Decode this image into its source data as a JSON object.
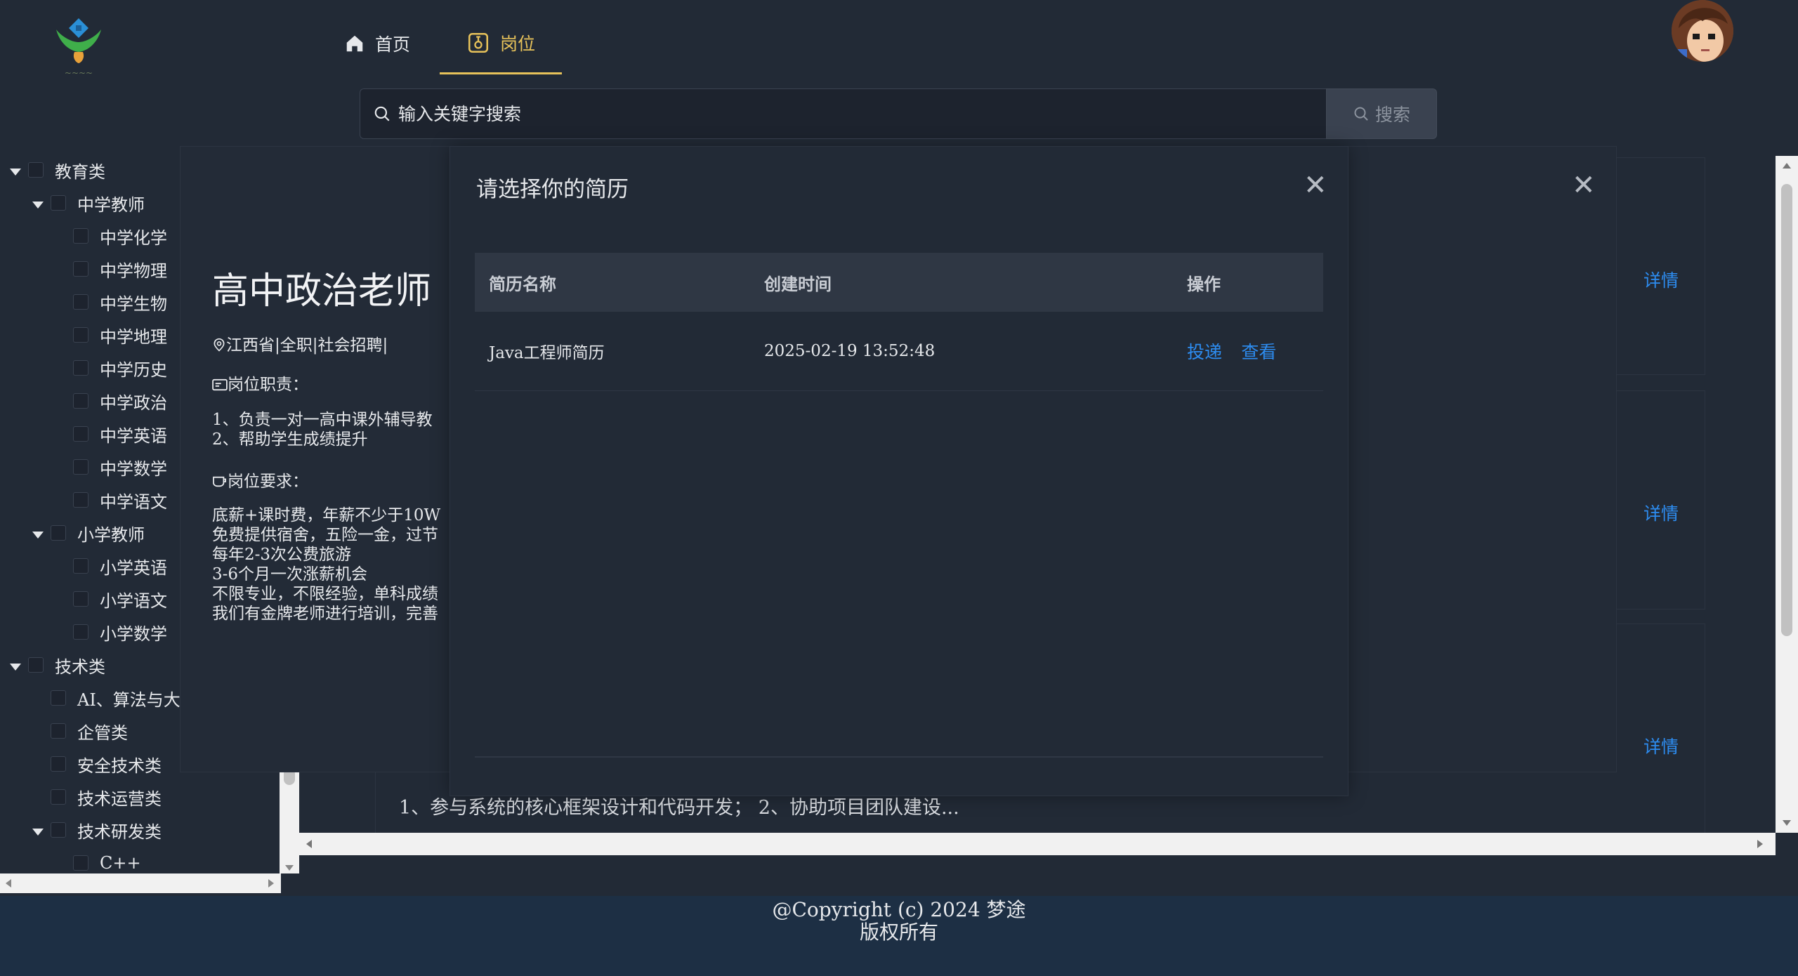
{
  "nav": {
    "home_label": "首页",
    "jobs_label": "岗位"
  },
  "search": {
    "placeholder": "输入关键字搜索",
    "button_label": "搜索"
  },
  "tree": [
    {
      "label": "教育类",
      "level": 0,
      "caret": true
    },
    {
      "label": "中学教师",
      "level": 1,
      "caret": true
    },
    {
      "label": "中学化学",
      "level": 2
    },
    {
      "label": "中学物理",
      "level": 2
    },
    {
      "label": "中学生物",
      "level": 2
    },
    {
      "label": "中学地理",
      "level": 2
    },
    {
      "label": "中学历史",
      "level": 2
    },
    {
      "label": "中学政治",
      "level": 2
    },
    {
      "label": "中学英语",
      "level": 2
    },
    {
      "label": "中学数学",
      "level": 2
    },
    {
      "label": "中学语文",
      "level": 2
    },
    {
      "label": "小学教师",
      "level": 1,
      "caret": true
    },
    {
      "label": "小学英语",
      "level": 2
    },
    {
      "label": "小学语文",
      "level": 2
    },
    {
      "label": "小学数学",
      "level": 2
    },
    {
      "label": "技术类",
      "level": 0,
      "caret": true
    },
    {
      "label": "AI、算法与大",
      "level": 1
    },
    {
      "label": "企管类",
      "level": 1
    },
    {
      "label": "安全技术类",
      "level": 1
    },
    {
      "label": "技术运营类",
      "level": 1
    },
    {
      "label": "技术研发类",
      "level": 1,
      "caret": true
    },
    {
      "label": "C++",
      "level": 2
    }
  ],
  "cards": {
    "detail_label": "详情",
    "desc": "1、参与系统的核心框架设计和代码开发； 2、协助项目团队建设..."
  },
  "job": {
    "title": "高中政治老师",
    "meta": "江西省|全职|社会招聘|",
    "duty_heading": "岗位职责：",
    "duties": [
      "1、负责一对一高中课外辅导教",
      "2、帮助学生成绩提升"
    ],
    "req_heading": "岗位要求：",
    "requirements": [
      "底薪+课时费，年薪不少于10W",
      "免费提供宿舍，五险一金，过节",
      "每年2-3次公费旅游",
      "3-6个月一次涨薪机会",
      "不限专业，不限经验，单科成绩",
      "我们有金牌老师进行培训，完善"
    ]
  },
  "modal": {
    "title": "请选择你的简历",
    "columns": [
      "简历名称",
      "创建时间",
      "操作"
    ],
    "rows": [
      {
        "name": "Java工程师简历",
        "created": "2025-02-19 13:52:48",
        "deliver": "投递",
        "view": "查看"
      }
    ]
  },
  "footer": {
    "line1": "@Copyright (c) 2024 梦途",
    "line2": "版权所有"
  },
  "colors": {
    "accent": "#e7c25a",
    "link": "#2d8cf0",
    "background": "#222a36",
    "footer": "#1d2f44"
  }
}
